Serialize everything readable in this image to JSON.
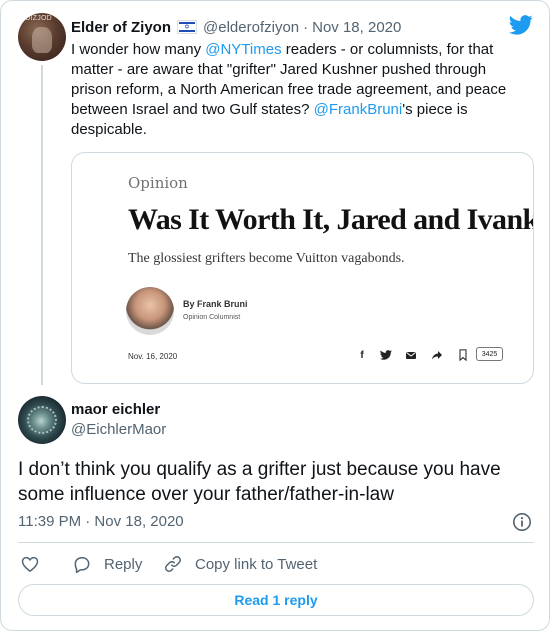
{
  "parent": {
    "avatar_text": "OIZJOD",
    "name": "Elder of Ziyon",
    "handle": "@elderofziyon",
    "separator": "·",
    "date": "Nov 18, 2020",
    "text": [
      {
        "t": "I wonder how many ",
        "link": false
      },
      {
        "t": "@NYTimes",
        "link": true
      },
      {
        "t": " readers - or columnists, for that matter - are aware that \"grifter\"  Jared Kushner pushed through prison reform, a North American free trade agreement, and peace between Israel and two Gulf states? ",
        "link": false
      },
      {
        "t": "@FrankBruni",
        "link": true
      },
      {
        "t": "'s piece is despicable.",
        "link": false
      }
    ]
  },
  "card": {
    "section": "Opinion",
    "headline": "Was It Worth It, Jared and Ivanka?",
    "deck": "The glossiest grifters become Vuitton vagabonds.",
    "byline": "By Frank Bruni",
    "role": "Opinion Columnist",
    "date": "Nov. 16, 2020",
    "share_count": "3425",
    "share_icons": [
      "facebook-icon",
      "twitter-icon",
      "email-icon",
      "share-arrow-icon",
      "bookmark-icon"
    ]
  },
  "reply": {
    "name": "maor eichler",
    "handle": "@EichlerMaor",
    "text": "I don’t think you qualify as a grifter just because you have some influence over your father/father-in-law",
    "time": "11:39 PM · Nov 18, 2020"
  },
  "actions": {
    "like_label": "",
    "reply_label": "Reply",
    "copy_label": "Copy link to Tweet",
    "read_label": "Read 1 reply"
  },
  "colors": {
    "link": "#1d9bf0",
    "muted": "#536471",
    "border": "#cfd9de",
    "text": "#0f1419"
  }
}
